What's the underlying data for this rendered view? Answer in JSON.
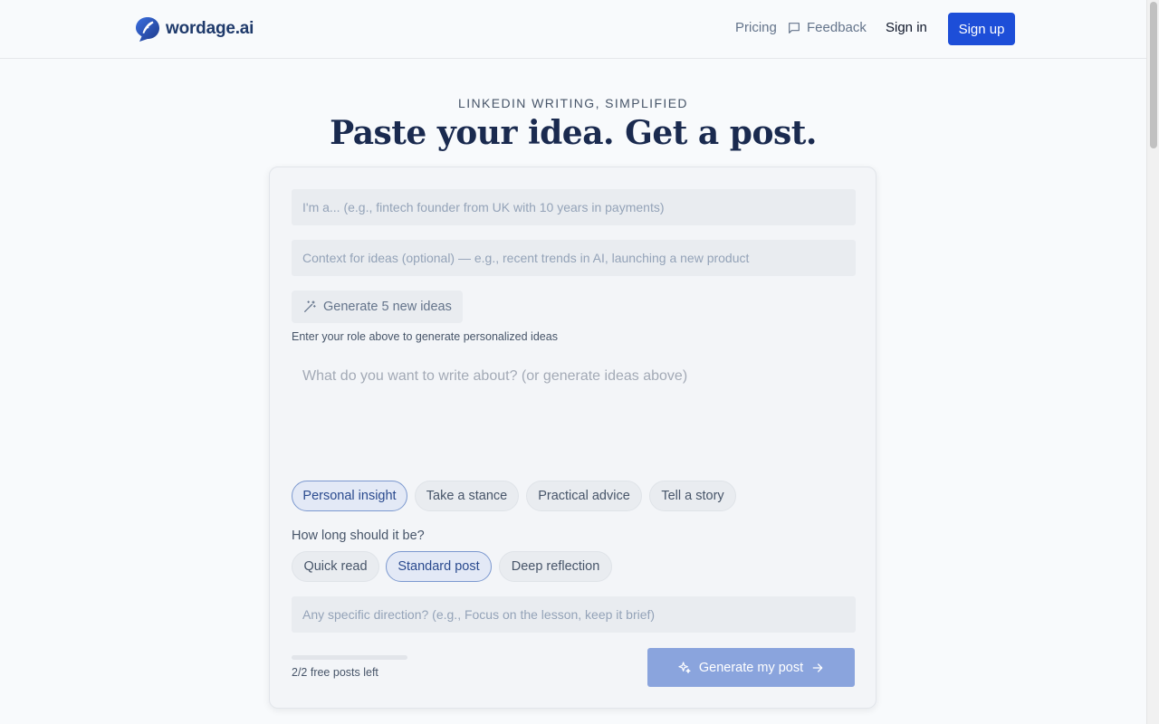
{
  "header": {
    "brand": "wordage.ai",
    "nav": {
      "pricing": "Pricing",
      "feedback": "Feedback",
      "sign_in": "Sign in",
      "sign_up": "Sign up"
    }
  },
  "hero": {
    "eyebrow": "LINKEDIN WRITING, SIMPLIFIED",
    "headline": "Paste your idea. Get a post."
  },
  "form": {
    "role_placeholder": "I'm a... (e.g., fintech founder from UK with 10 years in payments)",
    "context_placeholder": "Context for ideas (optional) — e.g., recent trends in AI, launching a new product",
    "generate_ideas_label": "Generate 5 new ideas",
    "generate_ideas_hint": "Enter your role above to generate personalized ideas",
    "topic_placeholder": "What do you want to write about? (or generate ideas above)",
    "angles": [
      "Personal insight",
      "Take a stance",
      "Practical advice",
      "Tell a story"
    ],
    "selected_angle": "Personal insight",
    "length_label": "How long should it be?",
    "lengths": [
      "Quick read",
      "Standard post",
      "Deep reflection"
    ],
    "selected_length": "Standard post",
    "direction_placeholder": "Any specific direction? (e.g., Focus on the lesson, keep it brief)",
    "free_posts_text": "2/2 free posts left",
    "free_posts_used_fraction": 0,
    "submit_label": "Generate my post"
  },
  "colors": {
    "primary": "#1d4ed8",
    "primary_disabled": "#8aa4dd",
    "headline": "#1a2a4f"
  }
}
